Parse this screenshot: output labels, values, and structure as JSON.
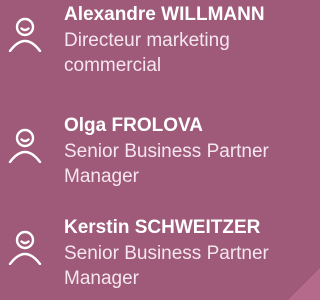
{
  "contacts": [
    {
      "name": "Alexandre WILLMANN",
      "role": "Directeur marketing commercial",
      "icon": "person-icon"
    },
    {
      "name": "Olga FROLOVA",
      "role": "Senior Business Partner Manager",
      "icon": "person-icon"
    },
    {
      "name": "Kerstin SCHWEITZER",
      "role": "Senior Business Partner Manager",
      "icon": "person-icon"
    }
  ],
  "colors": {
    "background": "#9e5a78",
    "text": "#ffffff",
    "corner_accent": "#b56a8b"
  }
}
